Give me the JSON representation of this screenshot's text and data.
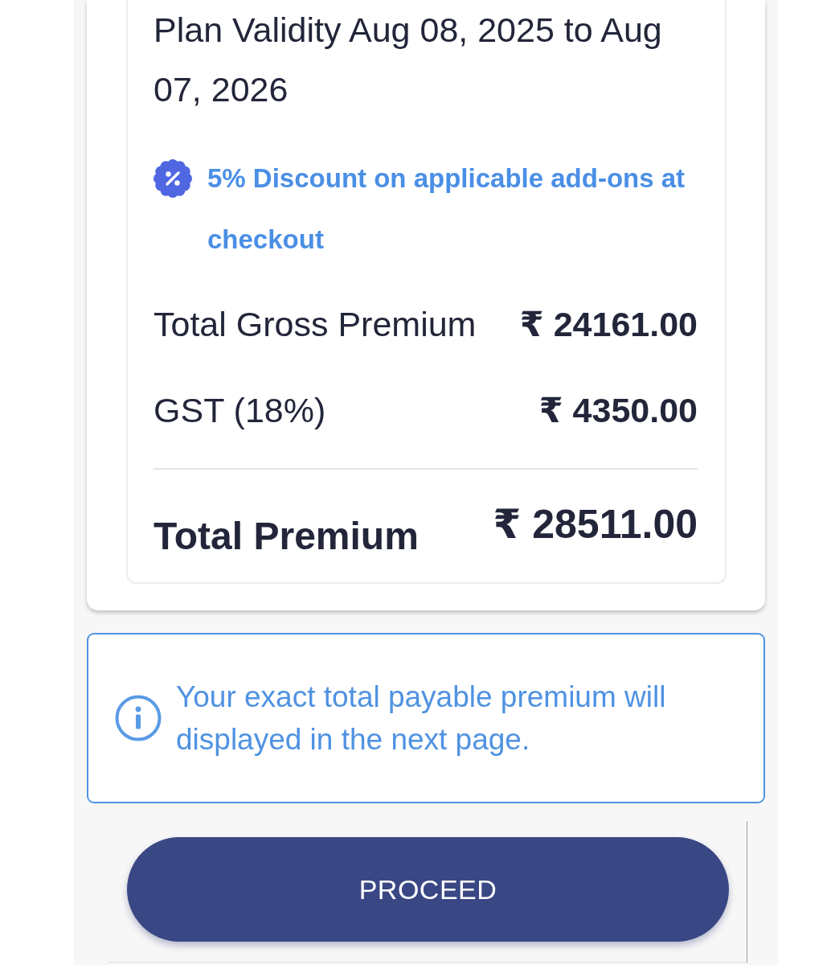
{
  "plan_card": {
    "validity": "Plan Validity Aug 08, 2025 to Aug 07, 2026",
    "discount_note": "5% Discount on applicable add-ons at checkout",
    "charges": [
      {
        "label": "Total Gross Premium",
        "amount": "₹ 24161.00"
      },
      {
        "label": "GST (18%)",
        "amount": "₹ 4350.00"
      }
    ],
    "total": {
      "label": "Total Premium",
      "amount": "₹ 28511.00"
    }
  },
  "info_note": "Your exact total payable premium will displayed in the next page.",
  "buttons": [
    {
      "label": "PROCEED"
    }
  ]
}
